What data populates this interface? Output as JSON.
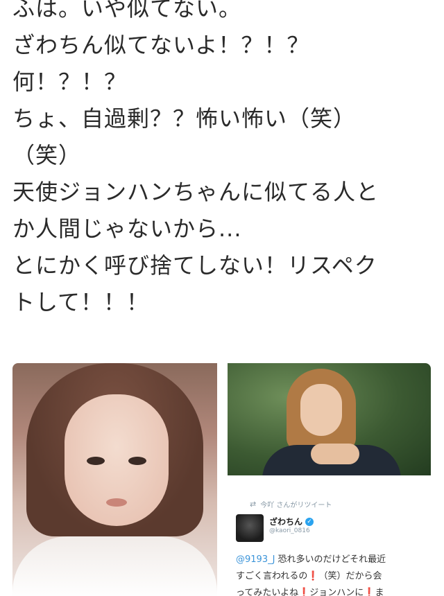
{
  "tweet": {
    "lines": [
      "ふは。いや似てない。",
      "ざわちん似てないよ！？！？",
      "何！？！？",
      "ちょ、自過剰？？怖い怖い（笑）",
      "（笑）",
      "天使ジョンハンちゃんに似てる人と",
      "か人間じゃないから...",
      "とにかく呼び捨てしない！リスペク",
      "トして！！！"
    ]
  },
  "embed": {
    "retweet_label": "今吖 さんがリツイート",
    "name": "ざわちん",
    "handle": "@kaori_0816",
    "mention": "@9193_J",
    "line1_text": " 恐れ多いのだけどそれ最近",
    "line2_text_a": "すごく言われるの",
    "line2_excl": "❗",
    "line2_text_b": "（笑）だから会",
    "line3_text_a": "ってみたいよね",
    "line3_excl_a": "❗",
    "line3_text_b": "ジョンハンに",
    "line3_excl_b": "❗",
    "line3_text_c": "ま"
  },
  "colors": {
    "text": "#2a2a2a",
    "mention": "#3b94d9",
    "verified": "#2aa3ef",
    "exclamation": "#d0232d",
    "muted": "#8899a6"
  },
  "icons": [
    "retweet-icon",
    "verified-icon"
  ]
}
